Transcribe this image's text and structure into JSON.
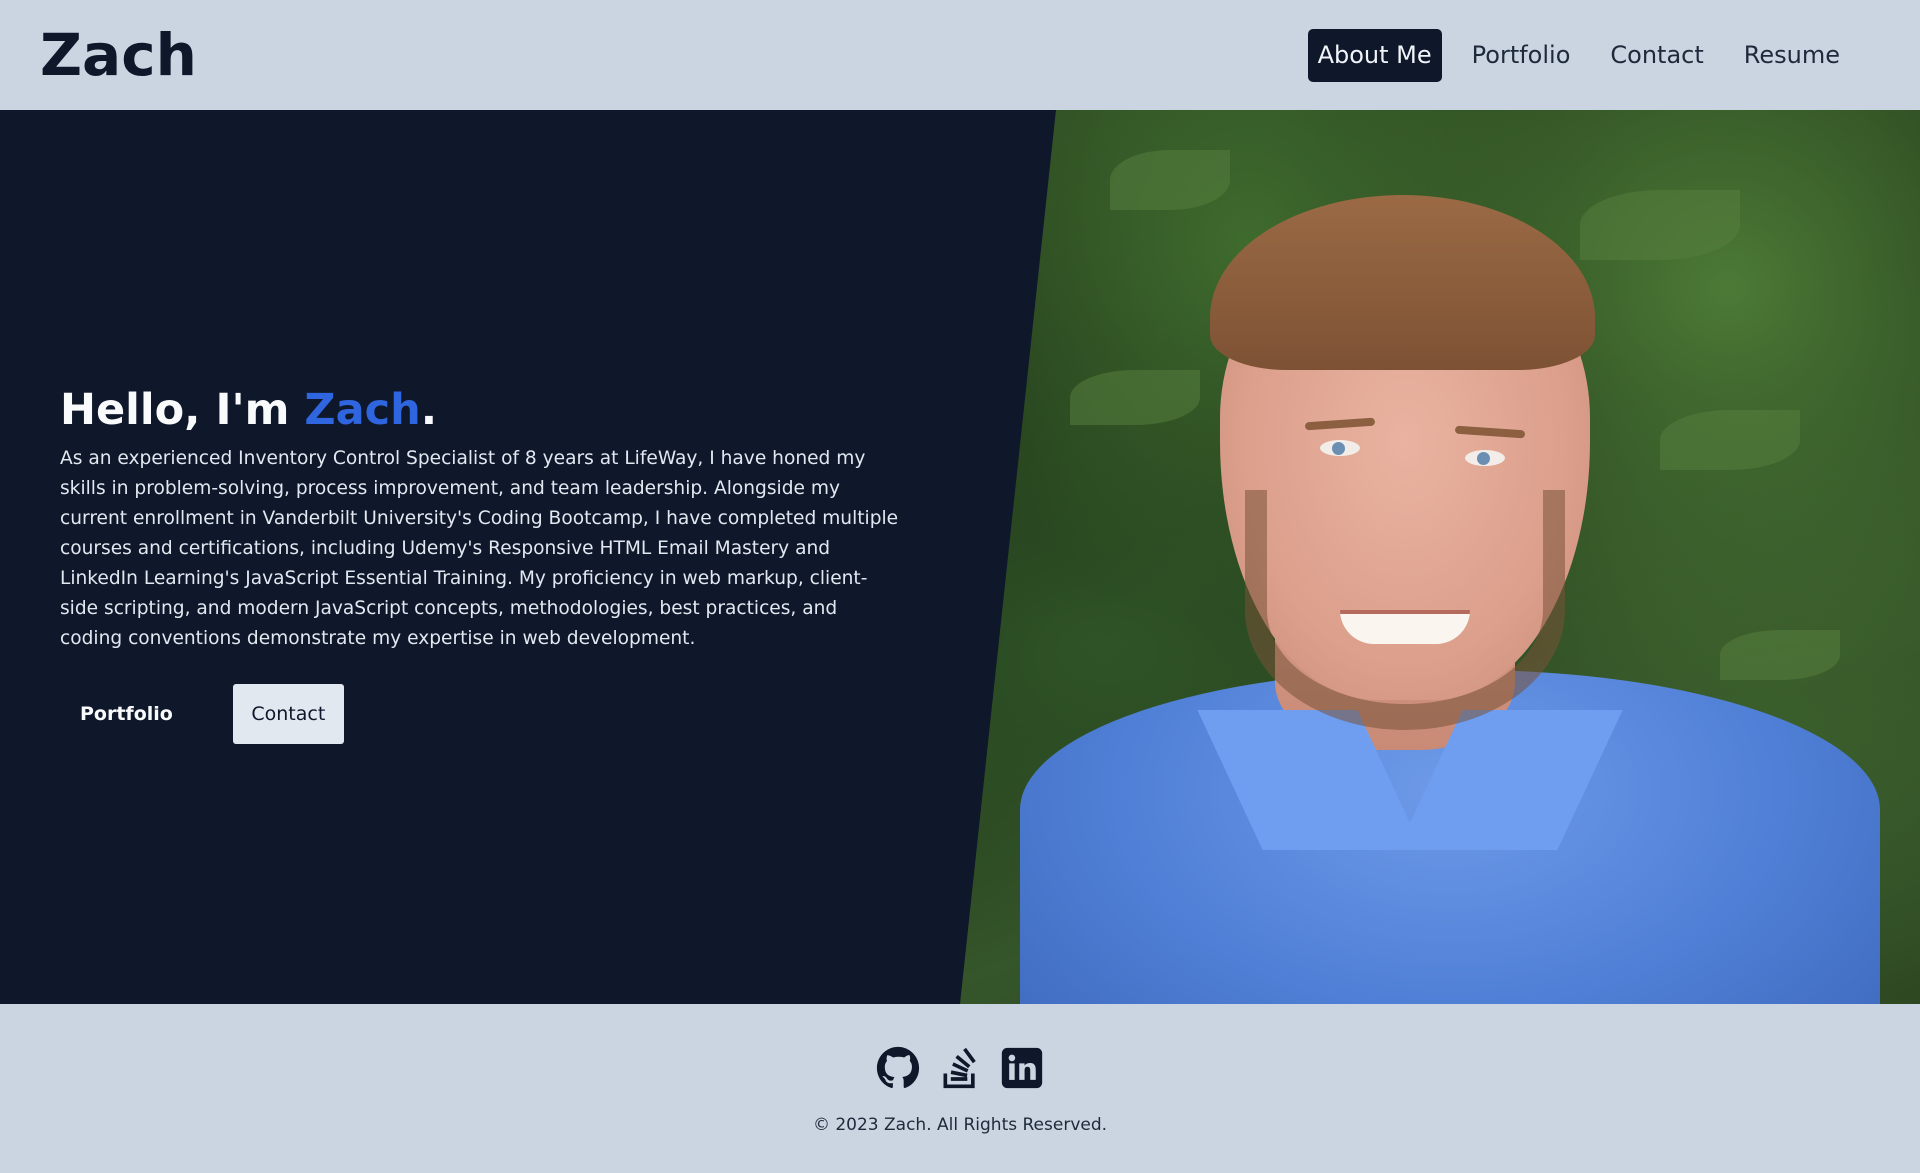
{
  "header": {
    "logo": "Zach",
    "nav": [
      {
        "label": "About Me",
        "active": true
      },
      {
        "label": "Portfolio",
        "active": false
      },
      {
        "label": "Contact",
        "active": false
      },
      {
        "label": "Resume",
        "active": false
      }
    ]
  },
  "hero": {
    "greeting": "Hello, I'm ",
    "name": "Zach",
    "period": ".",
    "description": "As an experienced Inventory Control Specialist of 8 years at LifeWay, I have honed my skills in problem-solving, process improvement, and team leadership. Alongside my current enrollment in Vanderbilt University's Coding Bootcamp, I have completed multiple courses and certifications, including Udemy's Responsive HTML Email Mastery and LinkedIn Learning's JavaScript Essential Training. My proficiency in web markup, client-side scripting, and modern JavaScript concepts, methodologies, best practices, and coding conventions demonstrate my expertise in web development.",
    "buttons": {
      "portfolio": "Portfolio",
      "contact": "Contact"
    },
    "photo_icon": "portrait-photo"
  },
  "footer": {
    "socials": [
      {
        "name": "github-icon"
      },
      {
        "name": "stackoverflow-icon"
      },
      {
        "name": "linkedin-icon"
      }
    ],
    "copyright": "© 2023 Zach. All Rights Reserved."
  },
  "colors": {
    "background": "#cbd5e1",
    "hero_bg": "#0f172a",
    "accent": "#2f66e0",
    "nav_active_bg": "#0f172a"
  }
}
